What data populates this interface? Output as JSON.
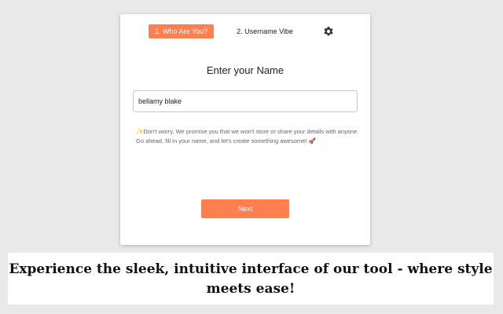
{
  "tabs": {
    "step1_label": "1. Who Are You?",
    "step2_label": "2. Username Vibe"
  },
  "settings": {
    "icon": "gear-icon"
  },
  "form": {
    "heading": "Enter your Name",
    "name_value": "bellamy blake",
    "privacy_note": "✨Don't worry, We promise you that we won't store or share your details with anyone. Go ahead, fill in your name, and let's create something awesome! 🚀",
    "next_label": "Next"
  },
  "caption": {
    "text": "Experience the sleek, intuitive interface of our tool - where style meets ease!"
  },
  "colors": {
    "accent": "#ff7f50",
    "background": "#e9e9e9",
    "card": "#ffffff"
  }
}
